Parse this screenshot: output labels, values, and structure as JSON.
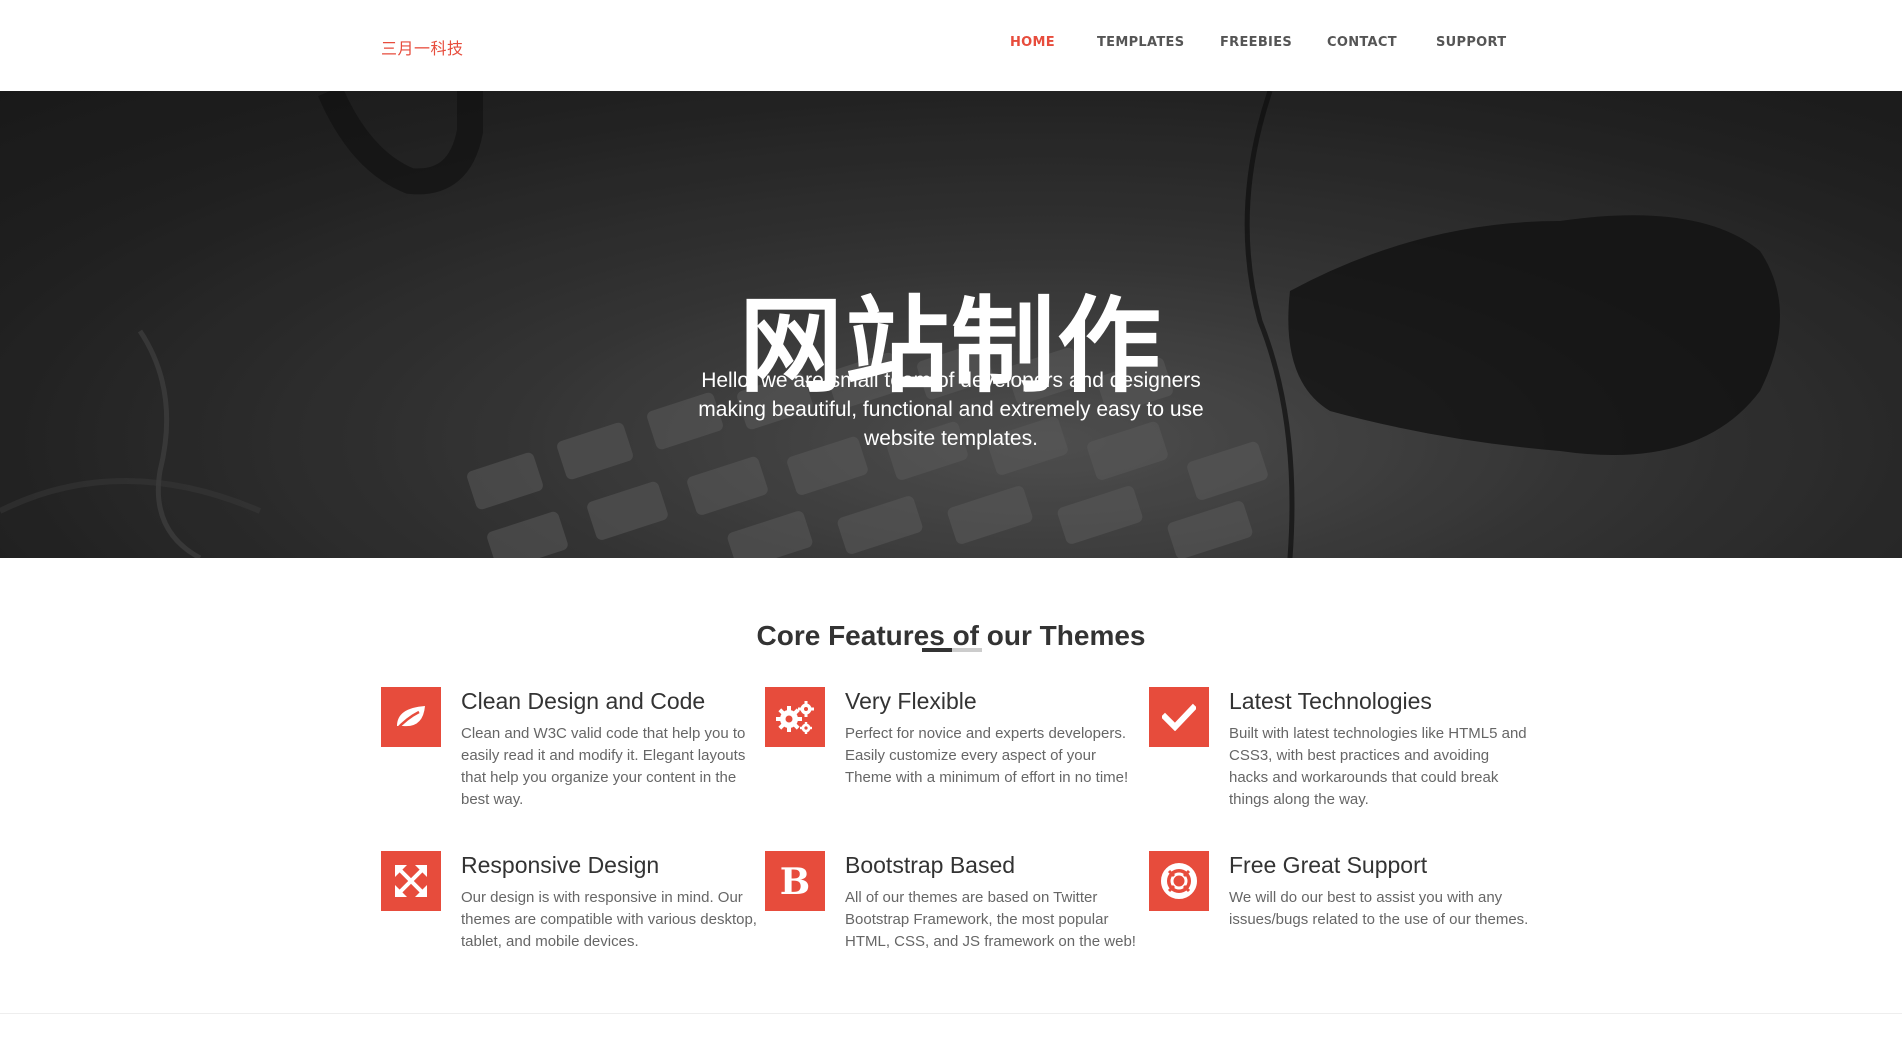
{
  "brand": {
    "logo": "三月一科技",
    "accent": "#e74c3c"
  },
  "nav": {
    "items": [
      {
        "label": "HOME",
        "active": true
      },
      {
        "label": "TEMPLATES",
        "active": false
      },
      {
        "label": "FREEBIES",
        "active": false
      },
      {
        "label": "CONTACT",
        "active": false
      },
      {
        "label": "SUPPORT",
        "active": false
      }
    ]
  },
  "hero": {
    "title": "网站制作",
    "subtitle": "Hello, we are small team of developers and designers making beautiful, functional and extremely easy to use website templates."
  },
  "features": {
    "title": "Core Features of our Themes",
    "items": [
      {
        "icon": "leaf-icon",
        "title": "Clean Design and Code",
        "text": "Clean and W3C valid code that help you to easily read it and modify it. Elegant layouts that help you organize your content in the best way."
      },
      {
        "icon": "gears-icon",
        "title": "Very Flexible",
        "text": "Perfect for novice and experts developers. Easily customize every aspect of your Theme with a minimum of effort in no time!"
      },
      {
        "icon": "checkmark-icon",
        "title": "Latest Technologies",
        "text": "Built with latest technologies like HTML5 and CSS3, with best practices and avoiding hacks and workarounds that could break things along the way."
      },
      {
        "icon": "expand-arrows-icon",
        "title": "Responsive Design",
        "text": "Our design is with responsive in mind. Our themes are compatible with various desktop, tablet, and mobile devices."
      },
      {
        "icon": "bootstrap-b-icon",
        "title": "Bootstrap Based",
        "text": "All of our themes are based on Twitter Bootstrap Framework, the most popular HTML, CSS, and JS framework on the web!"
      },
      {
        "icon": "lifebuoy-icon",
        "title": "Free Great Support",
        "text": "We will do our best to assist you with any issues/bugs related to the use of our themes."
      }
    ]
  }
}
